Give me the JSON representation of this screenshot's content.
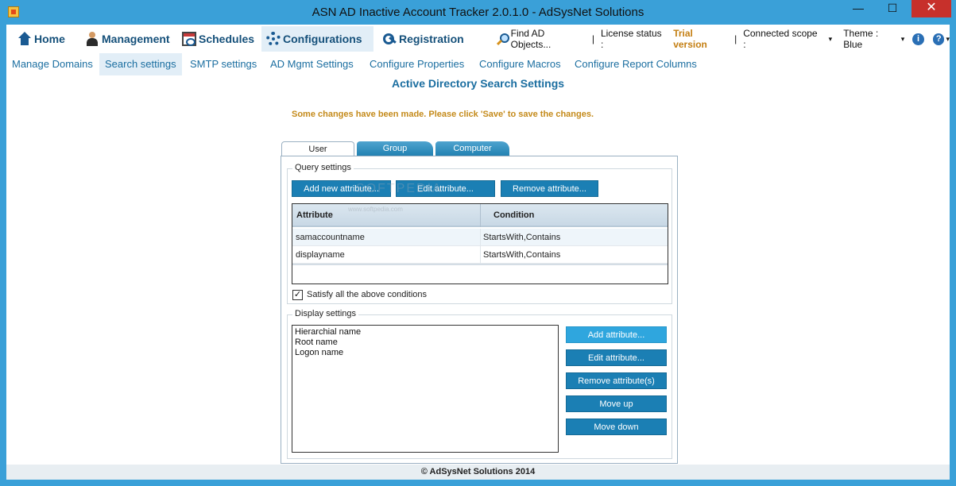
{
  "window": {
    "title": "ASN AD Inactive Account Tracker 2.0.1.0 - AdSysNet Solutions",
    "minimize": "—",
    "maximize": "☐",
    "close": "✕"
  },
  "menubar": {
    "items": [
      {
        "label": "Home",
        "icon": "home-icon"
      },
      {
        "label": "Management",
        "icon": "user-icon"
      },
      {
        "label": "Schedules",
        "icon": "calendar-icon"
      },
      {
        "label": "Configurations",
        "icon": "gear-icon"
      },
      {
        "label": "Registration",
        "icon": "key-icon"
      }
    ],
    "find_label": "Find AD Objects...",
    "license_label": "License status :",
    "license_value": "Trial version",
    "scope_label": "Connected scope :",
    "theme_label": "Theme : Blue",
    "info_glyph": "i",
    "help_glyph": "?",
    "caret": "▾"
  },
  "subnav": {
    "items": [
      "Manage Domains",
      "Search settings",
      "SMTP settings",
      "AD Mgmt Settings",
      "Configure Properties",
      "Configure Macros",
      "Configure Report Columns"
    ],
    "active": "Search settings"
  },
  "page": {
    "title": "Active Directory Search Settings",
    "notice": "Some changes have been made. Please click 'Save' to save the changes."
  },
  "tabs": {
    "items": [
      "User",
      "Group",
      "Computer"
    ],
    "active": "User"
  },
  "query_settings": {
    "legend": "Query settings",
    "add_button": "Add new attribute...",
    "edit_button": "Edit attribute...",
    "remove_button": "Remove attribute...",
    "columns": [
      "Attribute",
      "Condition"
    ],
    "rows": [
      {
        "attribute": "samaccountname",
        "condition": "StartsWith,Contains"
      },
      {
        "attribute": "displayname",
        "condition": "StartsWith,Contains"
      }
    ],
    "satisfy_all": {
      "checked": true,
      "label": "Satisfy all the above conditions",
      "glyph": "✓"
    }
  },
  "display_settings": {
    "legend": "Display settings",
    "items": [
      "Hierarchial name",
      "Root name",
      "Logon name"
    ],
    "add_button": "Add attribute...",
    "edit_button": "Edit attribute...",
    "remove_button": "Remove attribute(s)",
    "move_up_button": "Move up",
    "move_down_button": "Move down"
  },
  "watermark": {
    "text": "SOFTPEDIA",
    "url": "www.softpedia.com"
  },
  "footer": {
    "text": "© AdSysNet Solutions 2014"
  },
  "colors": {
    "frame": "#3aa0d8",
    "accent": "#1b7fb4",
    "link": "#1b6ea0",
    "notice": "#c48a1a",
    "trial": "#c47f13",
    "close": "#c7302b"
  }
}
